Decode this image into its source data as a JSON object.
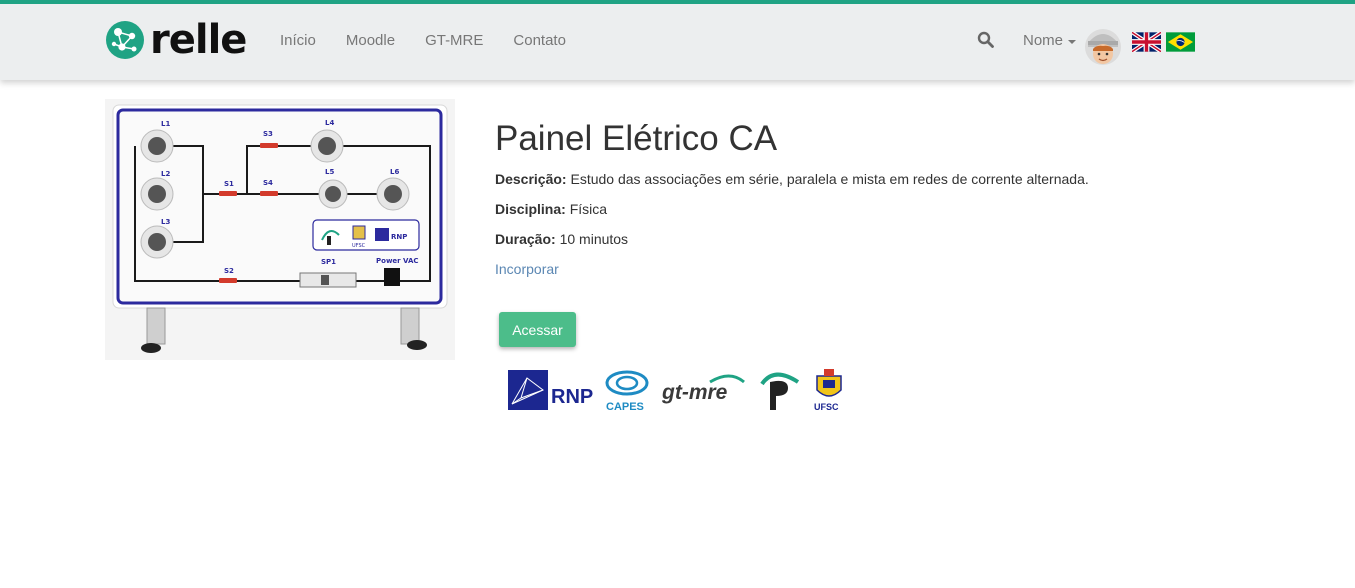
{
  "brand": {
    "name": "relle",
    "accent_color": "#1fa384"
  },
  "nav": {
    "items": [
      {
        "label": "Início"
      },
      {
        "label": "Moodle"
      },
      {
        "label": "GT-MRE"
      },
      {
        "label": "Contato"
      }
    ]
  },
  "header": {
    "search_icon": "search-icon",
    "user_name": "Nome",
    "languages": [
      "en",
      "pt-br"
    ]
  },
  "product_image": {
    "panel_labels": [
      "L1",
      "L2",
      "L3",
      "L4",
      "L5",
      "L6",
      "S1",
      "S2",
      "S3",
      "S4",
      "SP1",
      "Power VAC",
      "UFSC",
      "RNP"
    ]
  },
  "lab": {
    "title": "Painel Elétrico CA",
    "description_label": "Descrição:",
    "description": "Estudo das associações em série, paralela e mista em redes de corrente alternada.",
    "discipline_label": "Disciplina:",
    "discipline": "Física",
    "duration_label": "Duração:",
    "duration": "10 minutos",
    "embed_link": "Incorporar",
    "access_button": "Acessar",
    "access_color": "#4cbd8a"
  },
  "partner_logos": {
    "rnp": "RNP",
    "capes": "CAPES",
    "gtmre": "gt-mre",
    "ufsc": "UFSC"
  }
}
